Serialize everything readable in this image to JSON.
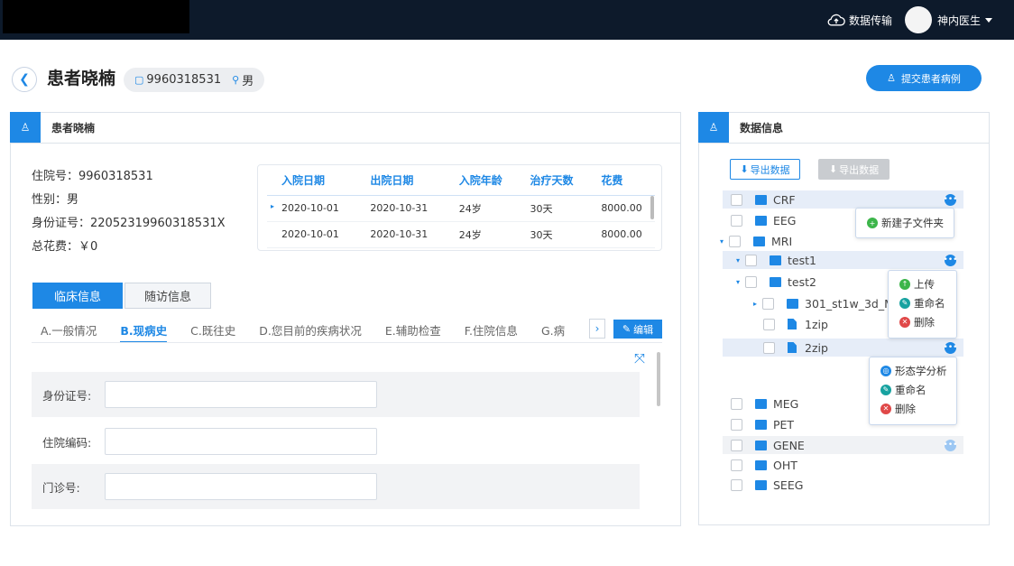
{
  "topbar": {
    "transfer_label": "数据传输",
    "user_name": "神内医生"
  },
  "header": {
    "title": "患者晓楠",
    "patient_id": "9960318531",
    "gender": "男",
    "submit_label": "提交患者病例"
  },
  "left_panel": {
    "title": "患者晓楠",
    "info": {
      "admission_no": "住院号：9960318531",
      "gender": "性别：男",
      "id_card": "身份证号：220523199603185 31X",
      "total_cost": "总花费：￥0"
    },
    "table": {
      "columns": [
        "入院日期",
        "出院日期",
        "入院年龄",
        "治疗天数",
        "花费"
      ],
      "rows": [
        [
          "2020-10-01",
          "2020-10-31",
          "24岁",
          "30天",
          "8000.00"
        ],
        [
          "2020-10-01",
          "2020-10-31",
          "24岁",
          "30天",
          "8000.00"
        ]
      ]
    },
    "tabs": [
      "临床信息",
      "随访信息"
    ],
    "subtabs": [
      "A.一般情况",
      "B.现病史",
      "C.既往史",
      "D.您目前的疾病状况",
      "E.辅助检查",
      "F.住院信息",
      "G.病"
    ],
    "edit_label": "编辑",
    "form": [
      {
        "label": "身份证号:",
        "value": ""
      },
      {
        "label": "住院编码:",
        "value": ""
      },
      {
        "label": "门诊号:",
        "value": ""
      }
    ]
  },
  "right_panel": {
    "title": "数据信息",
    "export_label": "导出数据",
    "export_disabled_label": "导出数据",
    "tree": {
      "crf": "CRF",
      "eeg": "EEG",
      "mri": "MRI",
      "test1": "test1",
      "test2": "test2",
      "folder301": "301_st1w_3d_M",
      "zip1": "1zip",
      "zip2": "2zip",
      "meg": "MEG",
      "pet": "PET",
      "gene": "GENE",
      "oht": "OHT",
      "seeg": "SEEG"
    },
    "menu_crf": {
      "new_sub": "新建子文件夹"
    },
    "menu_test1": {
      "upload": "上传",
      "rename": "重命名",
      "delete": "删除"
    },
    "menu_2zip": {
      "analysis": "形态学分析",
      "rename": "重命名",
      "delete": "删除"
    }
  },
  "colors": {
    "primary": "#1e88e5",
    "topbar": "#0d1a2b"
  }
}
